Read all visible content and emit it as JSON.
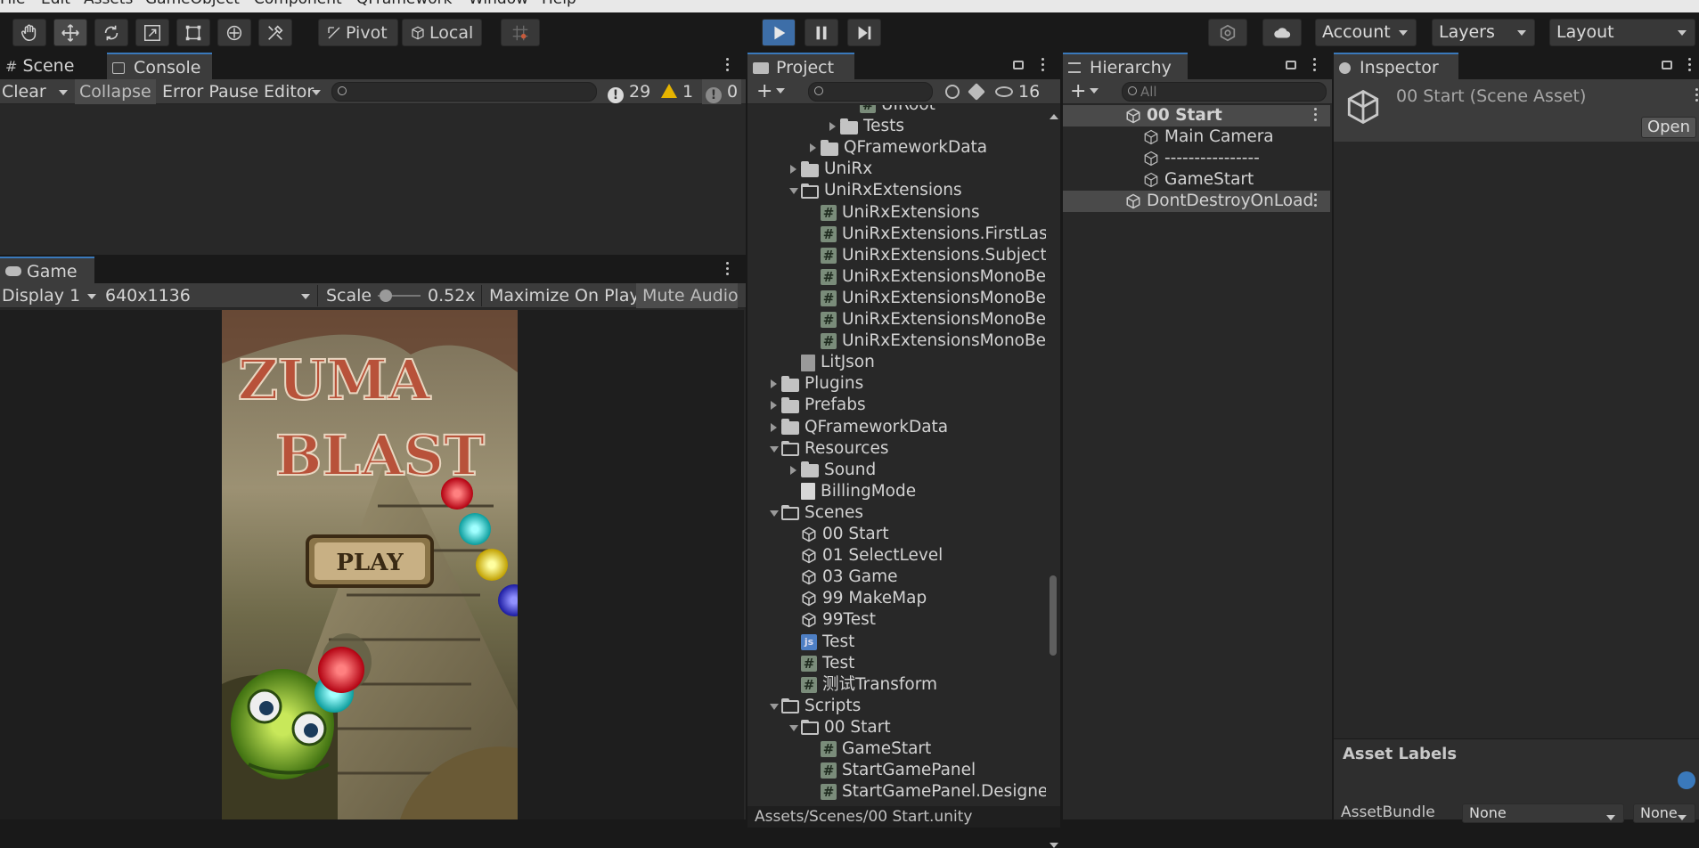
{
  "menu": [
    "File",
    "Edit",
    "Assets",
    "GameObject",
    "Component",
    "QFramework",
    "Window",
    "Help"
  ],
  "toolbar": {
    "tools": [
      "hand-tool",
      "move-tool",
      "rotate-tool",
      "scale-tool",
      "rect-tool",
      "transform-tool",
      "custom-tool"
    ],
    "pivot_label": "Pivot",
    "local_label": "Local",
    "account_label": "Account",
    "layers_label": "Layers",
    "layout_label": "Layout"
  },
  "scene_panel": {
    "tabs": [
      "Scene",
      "Console"
    ],
    "console": {
      "clear": "Clear",
      "collapse": "Collapse",
      "error_pause": "Error Pause",
      "editor": "Editor",
      "errors": "29",
      "warnings": "1",
      "infos": "0"
    }
  },
  "game_panel": {
    "tab": "Game",
    "display": "Display 1",
    "resolution": "640x1136",
    "scale_label": "Scale",
    "scale_value": "0.52x",
    "maximize": "Maximize On Play",
    "mute": "Mute Audio",
    "game_logo_top": "ZUMA",
    "game_logo_bottom": "BLAST",
    "play_button": "PLAY"
  },
  "project": {
    "tab": "Project",
    "hidden_count": "16",
    "items": [
      {
        "label": "UIRoot",
        "indent": 4,
        "icon": "hash",
        "fold": "",
        "cut": true
      },
      {
        "label": "Tests",
        "indent": 3,
        "icon": "folder",
        "fold": "r"
      },
      {
        "label": "QFrameworkData",
        "indent": 2,
        "icon": "folder",
        "fold": "r"
      },
      {
        "label": "UniRx",
        "indent": 1,
        "icon": "folder",
        "fold": "r"
      },
      {
        "label": "UniRxExtensions",
        "indent": 1,
        "icon": "folder-open",
        "fold": "d"
      },
      {
        "label": "UniRxExtensions",
        "indent": 2,
        "icon": "hash",
        "fold": ""
      },
      {
        "label": "UniRxExtensions.FirstLas",
        "indent": 2,
        "icon": "hash",
        "fold": ""
      },
      {
        "label": "UniRxExtensions.Subject",
        "indent": 2,
        "icon": "hash",
        "fold": ""
      },
      {
        "label": "UniRxExtensionsMonoBe",
        "indent": 2,
        "icon": "hash",
        "fold": ""
      },
      {
        "label": "UniRxExtensionsMonoBe",
        "indent": 2,
        "icon": "hash",
        "fold": ""
      },
      {
        "label": "UniRxExtensionsMonoBe",
        "indent": 2,
        "icon": "hash",
        "fold": ""
      },
      {
        "label": "UniRxExtensionsMonoBe",
        "indent": 2,
        "icon": "hash",
        "fold": ""
      },
      {
        "label": "LitJson",
        "indent": 1,
        "icon": "dll",
        "fold": ""
      },
      {
        "label": "Plugins",
        "indent": 0,
        "icon": "folder",
        "fold": "r"
      },
      {
        "label": "Prefabs",
        "indent": 0,
        "icon": "folder",
        "fold": "r"
      },
      {
        "label": "QFrameworkData",
        "indent": 0,
        "icon": "folder",
        "fold": "r"
      },
      {
        "label": "Resources",
        "indent": 0,
        "icon": "folder-open",
        "fold": "d"
      },
      {
        "label": "Sound",
        "indent": 1,
        "icon": "folder",
        "fold": "r"
      },
      {
        "label": "BillingMode",
        "indent": 1,
        "icon": "doc",
        "fold": ""
      },
      {
        "label": "Scenes",
        "indent": 0,
        "icon": "folder-open",
        "fold": "d"
      },
      {
        "label": "00 Start",
        "indent": 1,
        "icon": "unity",
        "fold": ""
      },
      {
        "label": "01 SelectLevel",
        "indent": 1,
        "icon": "unity",
        "fold": ""
      },
      {
        "label": "03 Game",
        "indent": 1,
        "icon": "unity",
        "fold": ""
      },
      {
        "label": "99 MakeMap",
        "indent": 1,
        "icon": "unity",
        "fold": ""
      },
      {
        "label": "99Test",
        "indent": 1,
        "icon": "unity",
        "fold": ""
      },
      {
        "label": "Test",
        "indent": 1,
        "icon": "js",
        "fold": ""
      },
      {
        "label": "Test",
        "indent": 1,
        "icon": "hash",
        "fold": ""
      },
      {
        "label": "测试Transform",
        "indent": 1,
        "icon": "hash",
        "fold": ""
      },
      {
        "label": "Scripts",
        "indent": 0,
        "icon": "folder-open",
        "fold": "d"
      },
      {
        "label": "00 Start",
        "indent": 1,
        "icon": "folder-open",
        "fold": "d"
      },
      {
        "label": "GameStart",
        "indent": 2,
        "icon": "hash",
        "fold": ""
      },
      {
        "label": "StartGamePanel",
        "indent": 2,
        "icon": "hash",
        "fold": ""
      },
      {
        "label": "StartGamePanel.Designe",
        "indent": 2,
        "icon": "hash",
        "fold": ""
      }
    ],
    "footer_path": "Assets/Scenes/00 Start.unity"
  },
  "hierarchy": {
    "tab": "Hierarchy",
    "search_placeholder": "All",
    "items": [
      {
        "label": "00 Start",
        "indent": 0,
        "icon": "unity",
        "selected": true,
        "bold": true
      },
      {
        "label": "Main Camera",
        "indent": 1,
        "icon": "cube",
        "selected": false,
        "bold": false
      },
      {
        "label": "----------------",
        "indent": 1,
        "icon": "cube",
        "selected": false,
        "bold": false
      },
      {
        "label": "GameStart",
        "indent": 1,
        "icon": "cube",
        "selected": false,
        "bold": false
      },
      {
        "label": "DontDestroyOnLoad",
        "indent": 0,
        "icon": "unity",
        "selected": true,
        "bold": false
      }
    ]
  },
  "inspector": {
    "tab": "Inspector",
    "title": "00 Start (Scene Asset)",
    "open_label": "Open",
    "asset_labels": "Asset Labels",
    "asset_bundle_label": "AssetBundle",
    "bundle_value": "None",
    "variant_value": "None"
  }
}
